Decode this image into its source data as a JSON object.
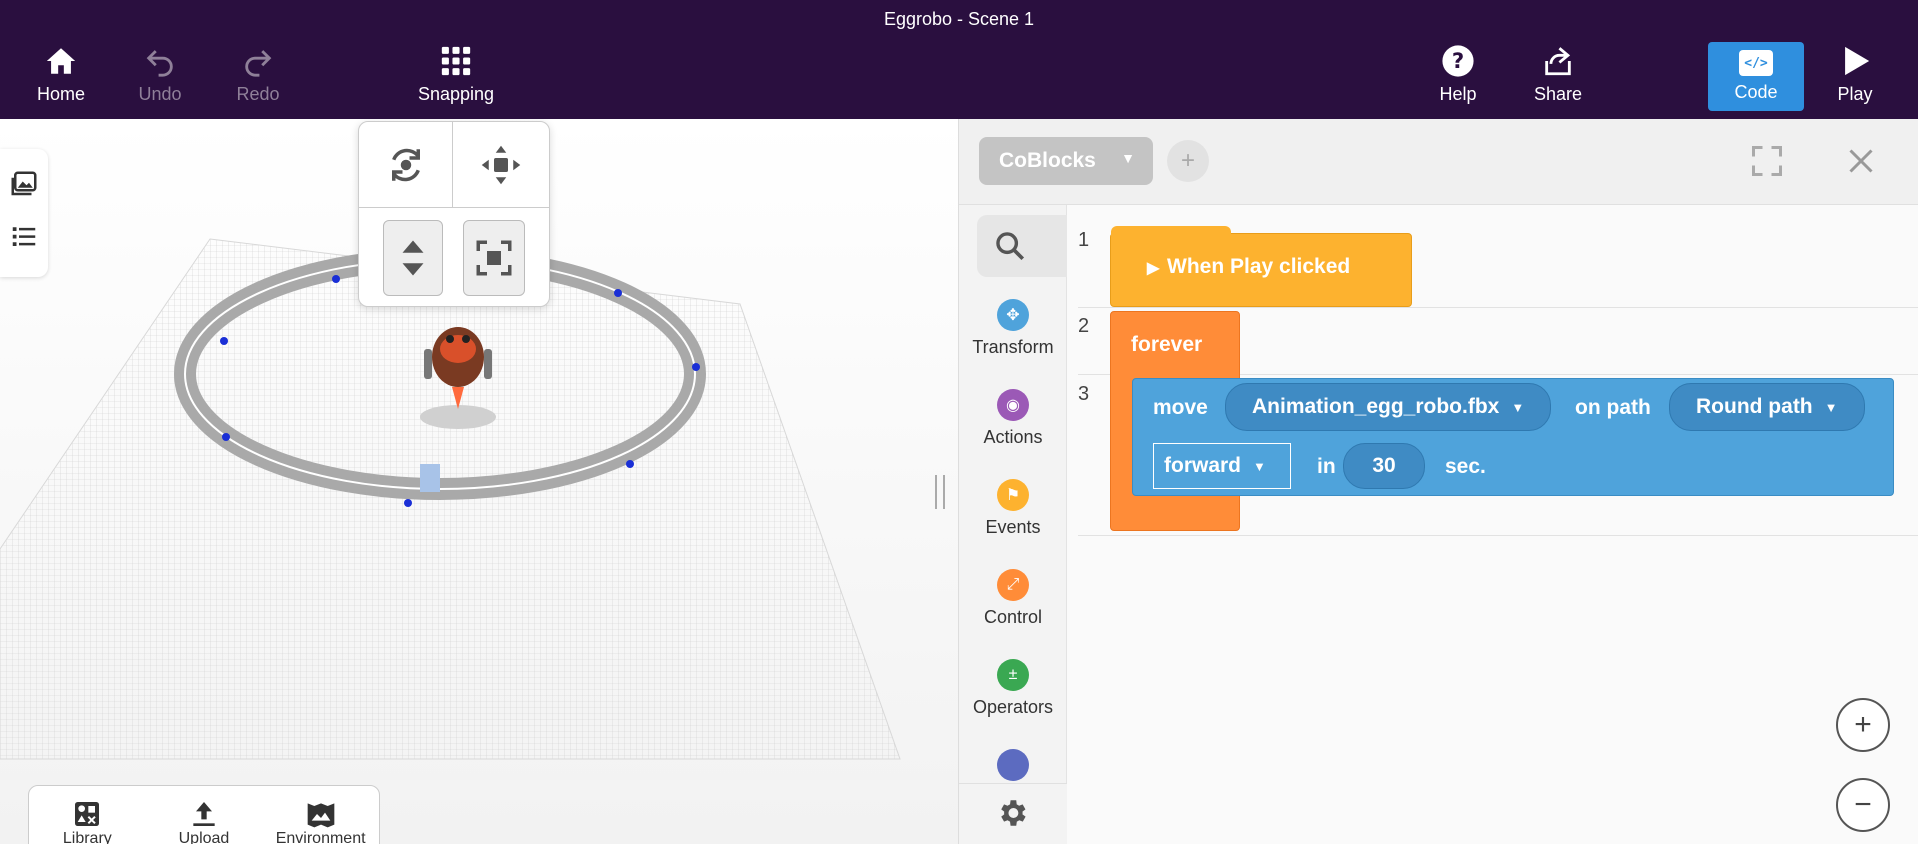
{
  "app": {
    "title": "Eggrobo - Scene 1"
  },
  "toolbar": {
    "home": "Home",
    "undo": "Undo",
    "redo": "Redo",
    "snapping": "Snapping",
    "help": "Help",
    "share": "Share",
    "code": "Code",
    "code_icon": "</>",
    "play": "Play"
  },
  "viewport": {
    "bottom_tray": [
      "Library",
      "Upload",
      "Environment"
    ]
  },
  "code_panel": {
    "tab_name": "CoBlocks",
    "add_tab": "+",
    "categories": [
      "Transform",
      "Actions",
      "Events",
      "Control",
      "Operators"
    ],
    "settings": "Settings",
    "lines": [
      "1",
      "2",
      "3"
    ],
    "blocks": {
      "hat": "When Play clicked",
      "forever": "forever",
      "move_word": "move",
      "object": "Animation_egg_robo.fbx",
      "on_path": "on path",
      "path": "Round path",
      "direction": "forward",
      "in_word": "in",
      "duration": "30",
      "unit": "sec."
    },
    "zoom_in": "+",
    "zoom_out": "−"
  },
  "colors": {
    "topbar": "#2a0f3f",
    "accent": "#2f8fde",
    "events_block": "#fdb22f",
    "control_block": "#ff8c38",
    "transform_block": "#4fa3db"
  }
}
